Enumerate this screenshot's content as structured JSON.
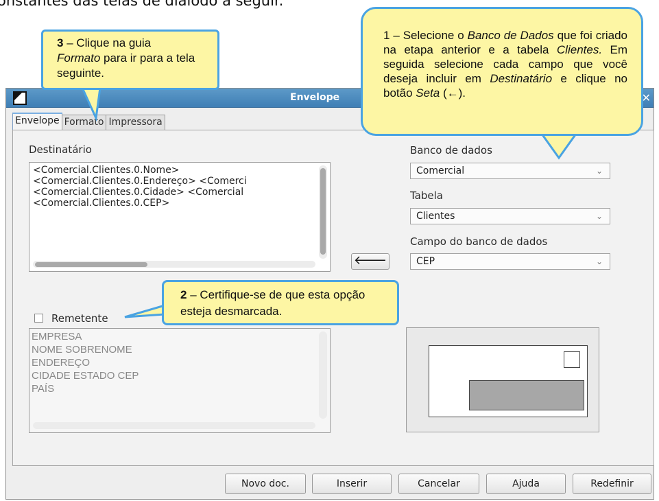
{
  "caption": "onstantes das telas de diálodo a seguir.",
  "window": {
    "title": "Envelope",
    "close_glyph": "✕"
  },
  "tabs": [
    {
      "label": "Envelope",
      "active": true
    },
    {
      "label": "Formato",
      "active": false
    },
    {
      "label": "Impressora",
      "active": false
    }
  ],
  "recipient": {
    "label": "Destinatário",
    "lines": [
      "<Comercial.Clientes.0.Nome>",
      "<Comercial.Clientes.0.Endereço> <Comerci",
      "<Comercial.Clientes.0.Cidade> <Comercial",
      "<Comercial.Clientes.0.CEP>"
    ]
  },
  "sender": {
    "checkbox_label": "Remetente",
    "checked": false,
    "lines": [
      "EMPRESA",
      "NOME SOBRENOME",
      "ENDEREÇO",
      "CIDADE ESTADO CEP",
      "PAÍS"
    ]
  },
  "database": {
    "db_label": "Banco de dados",
    "db_value": "Comercial",
    "table_label": "Tabela",
    "table_value": "Clientes",
    "field_label": "Campo do banco de dados",
    "field_value": "CEP",
    "insert_arrow_glyph": "🡐"
  },
  "buttons": {
    "new_doc": "Novo doc.",
    "insert": "Inserir",
    "cancel": "Cancelar",
    "help": "Ajuda",
    "reset": "Redefinir"
  },
  "callouts": {
    "c3_number": "3",
    "c3_pre": " – Clique na guia",
    "c3_em": "Formato",
    "c3_post": " para ir para a tela seguinte.",
    "c1_pre": "1 – Selecione o ",
    "c1_em1": "Banco de Dados",
    "c1_mid1": " que foi criado na etapa anterior e a tabela ",
    "c1_em2": "Clientes.",
    "c1_mid2": " Em seguida selecione cada campo que você deseja incluir em ",
    "c1_em3": "Destinatário",
    "c1_mid3": " e clique no botão ",
    "c1_em4": "Seta",
    "c1_post": " (←).",
    "c2_number": "2",
    "c2_text": " – Certifique-se  de que esta opção esteja desmarcada."
  },
  "colors": {
    "callout_fill": "#fdf6a4",
    "callout_border": "#4aa3e2",
    "titlebar": "#4a8bbf"
  }
}
